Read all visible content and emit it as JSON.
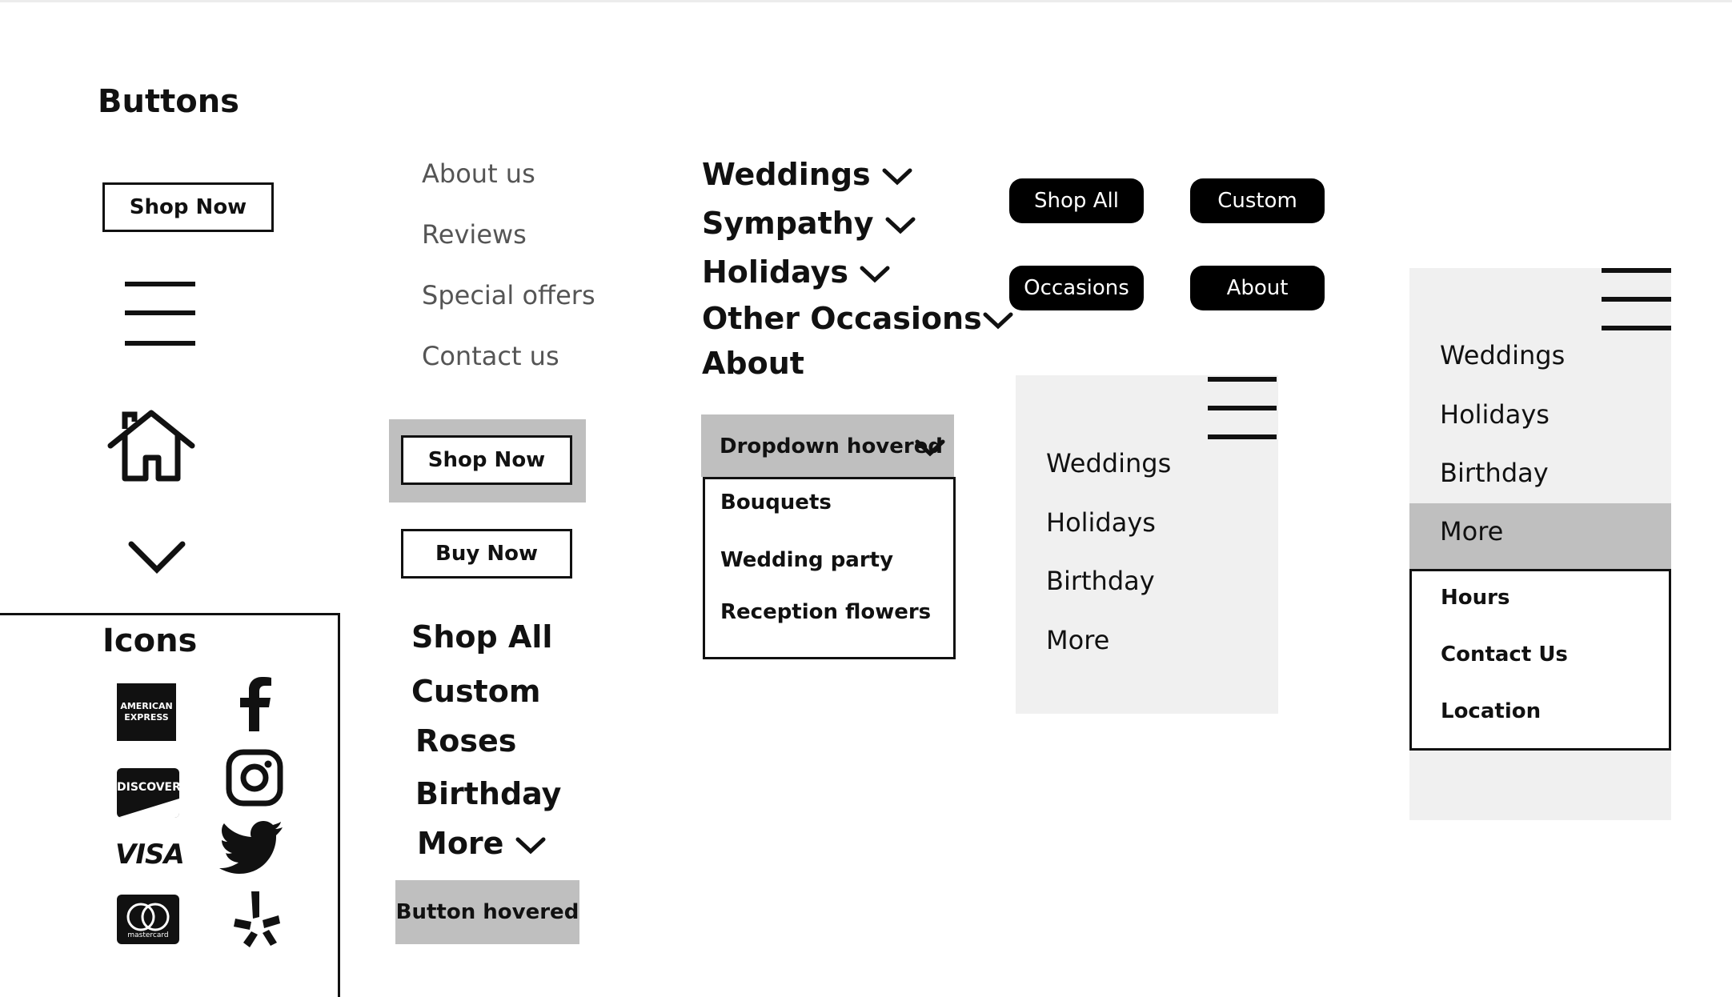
{
  "title": "Buttons",
  "buttons": {
    "shop_now": "Shop Now",
    "shop_now_hover": "Shop Now",
    "buy_now": "Buy Now",
    "button_hovered": "Button hovered"
  },
  "text_nav": [
    "About us",
    "Reviews",
    "Special offers",
    "Contact us"
  ],
  "category_nav": {
    "weddings": "Weddings",
    "sympathy": "Sympathy",
    "holidays": "Holidays",
    "other": "Other Occasions",
    "about": "About"
  },
  "dropdown": {
    "label": "Dropdown hovered",
    "items": [
      "Bouquets",
      "Wedding party",
      "Reception flowers"
    ]
  },
  "pills": {
    "shop_all": "Shop All",
    "custom": "Custom",
    "occasions": "Occasions",
    "about": "About"
  },
  "mobile_menu": {
    "items": [
      "Weddings",
      "Holidays",
      "Birthday",
      "More"
    ]
  },
  "mobile_menu_expanded": {
    "items": [
      "Weddings",
      "Holidays",
      "Birthday",
      "More"
    ],
    "sub_items": [
      "Hours",
      "Contact Us",
      "Location"
    ]
  },
  "secondary_nav": {
    "shop_all": "Shop All",
    "custom": "Custom",
    "roses": "Roses",
    "birthday": "Birthday",
    "more": "More"
  },
  "icons": {
    "title": "Icons",
    "amex_text": "AMERICAN EXPRESS",
    "discover_text": "DISCOVER",
    "visa_text": "VISA",
    "mastercard_text": "mastercard",
    "list": [
      "amex-icon",
      "facebook-icon",
      "discover-icon",
      "instagram-icon",
      "visa-icon",
      "twitter-icon",
      "mastercard-icon",
      "yelp-icon"
    ]
  },
  "colors": {
    "black": "#000000",
    "panel_gray": "#f0f0f0",
    "hover_gray": "#bfbfbf",
    "text_gray": "#555555"
  }
}
